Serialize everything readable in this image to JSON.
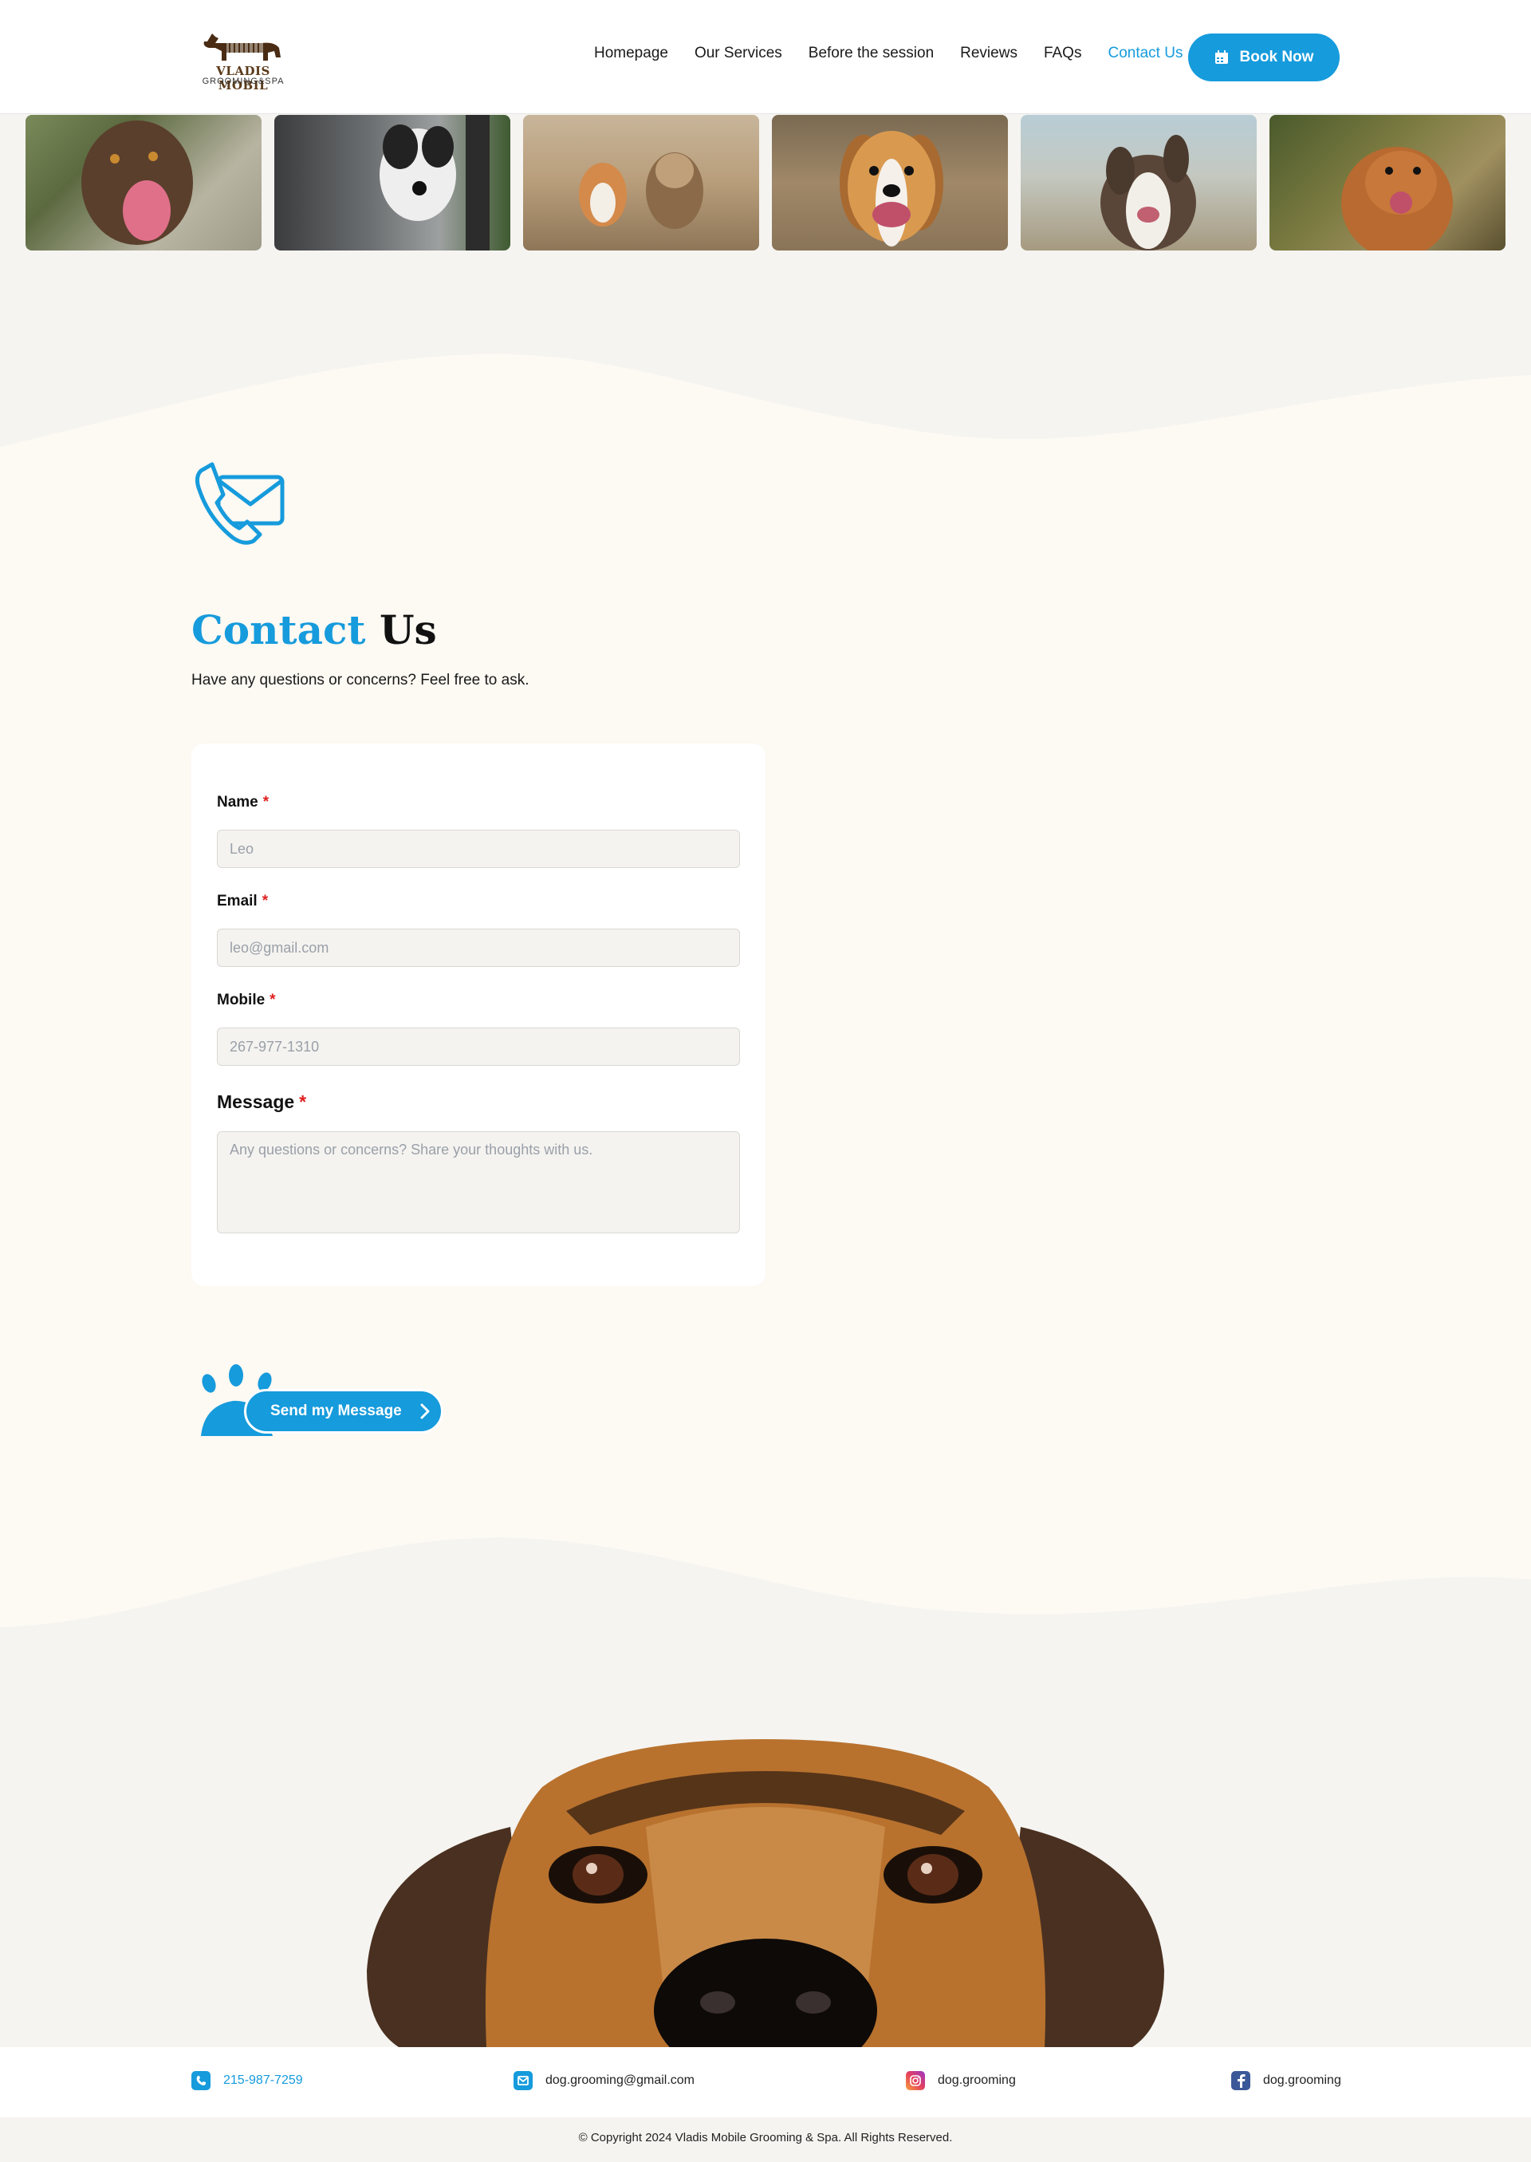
{
  "header": {
    "logo_name": "VLADIS MOBIL",
    "logo_sub": "GROOMING&SPA",
    "nav": [
      {
        "label": "Homepage"
      },
      {
        "label": "Our Services"
      },
      {
        "label": "Before the session"
      },
      {
        "label": "Reviews"
      },
      {
        "label": "FAQs"
      },
      {
        "label": "Contact Us",
        "active": true
      }
    ],
    "book_label": "Book Now"
  },
  "contact": {
    "title_blue": "Contact",
    "title_dark": "Us",
    "subtitle": "Have any questions or concerns? Feel free to ask."
  },
  "form": {
    "name_label": "Name",
    "name_placeholder": "Leo",
    "email_label": "Email",
    "email_placeholder": "leo@gmail.com",
    "mobile_label": "Mobile",
    "mobile_placeholder": "267-977-1310",
    "message_label": "Message",
    "message_placeholder": "Any questions or concerns? Share your thoughts with us.",
    "required_mark": "*",
    "send_label": "Send my Message"
  },
  "footer": {
    "phone": "215-987-7259",
    "email": "dog.grooming@gmail.com",
    "instagram": "dog.grooming",
    "facebook": "dog.grooming",
    "copyright": "© Copyright 2024 Vladis Mobile Grooming & Spa. All Rights Reserved."
  },
  "colors": {
    "accent": "#169bdc",
    "cream": "#fdf9f3",
    "gray_bg": "#f5f4f1",
    "required": "#e02020"
  },
  "icons": [
    "calendar-icon",
    "chevron-right-icon",
    "phone-icon",
    "mail-icon",
    "instagram-icon",
    "facebook-icon",
    "phone-envelope-icon",
    "paw-icon"
  ]
}
